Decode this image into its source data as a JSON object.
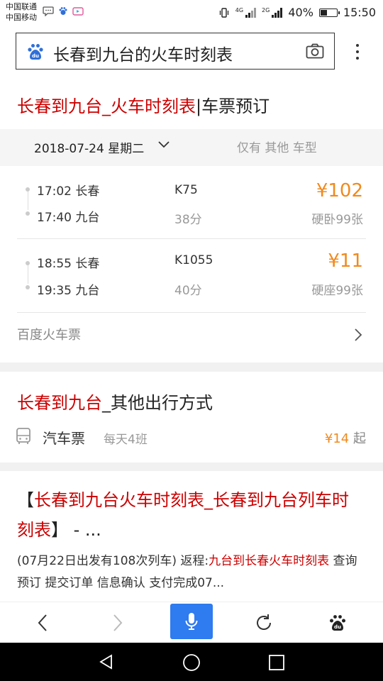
{
  "status_bar": {
    "carrier_1": "中国联通",
    "carrier_2": "中国移动",
    "net_1": "4G",
    "net_2": "2G",
    "battery": "40%",
    "time": "15:50"
  },
  "search": {
    "query": "长春到九台的火车时刻表",
    "icons": [
      "baidu-paw-icon",
      "camera-icon",
      "more-vertical-icon"
    ]
  },
  "train_card": {
    "title_red": "长春到九台_火车时刻表",
    "title_rest": "|车票预订",
    "date": "2018-07-24 星期二",
    "filter_label": "仅有 其他 车型",
    "trains": [
      {
        "depart_time": "17:02 长春",
        "arrive_time": "17:40 九台",
        "number": "K75",
        "duration": "38分",
        "price": "¥102",
        "seat": "硬卧99张"
      },
      {
        "depart_time": "18:55 长春",
        "arrive_time": "19:35 九台",
        "number": "K1055",
        "duration": "40分",
        "price": "¥11",
        "seat": "硬座99张"
      }
    ],
    "source": "百度火车票"
  },
  "other_travel": {
    "title_red": "长春到九台",
    "title_rest": "_其他出行方式",
    "bus_label": "汽车票",
    "bus_frequency": "每天4班",
    "bus_price": "¥14",
    "bus_price_suffix": "起"
  },
  "result_3": {
    "bracket_open": "【",
    "title_red": "长春到九台火车时刻表_长春到九台列车时刻表",
    "title_rest": "】 - ...",
    "desc_1": "(07月22日出发有108次列车) 返程:",
    "desc_red": "九台到长春火车时刻表",
    "desc_2": " 查询预订 提交订单 信息确认 支付完成07..."
  },
  "bottom_nav": {
    "items": [
      "back-icon",
      "forward-icon",
      "microphone-icon",
      "refresh-icon",
      "baidu-paw-icon"
    ],
    "accent": "#2f7bf0"
  },
  "colors": {
    "title_red": "#cc0000",
    "price_orange": "#f08a1d",
    "muted": "#999999"
  }
}
